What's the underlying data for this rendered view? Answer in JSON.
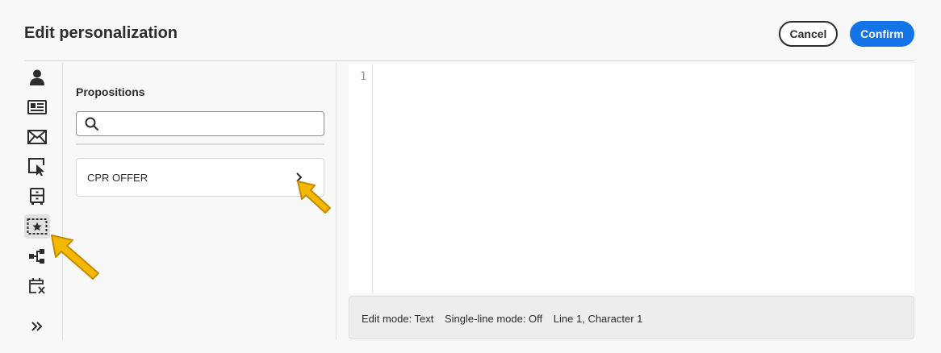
{
  "header": {
    "title": "Edit personalization",
    "cancel_label": "Cancel",
    "confirm_label": "Confirm"
  },
  "rail": {
    "items": [
      {
        "icon": "profile-icon"
      },
      {
        "icon": "audience-icon"
      },
      {
        "icon": "email-icon"
      },
      {
        "icon": "interaction-icon"
      },
      {
        "icon": "cabinet-icon"
      },
      {
        "icon": "offer-star-icon",
        "selected": true
      },
      {
        "icon": "flow-icon"
      },
      {
        "icon": "calendar-x-icon"
      },
      {
        "icon": "expand-chevron-double-icon"
      }
    ]
  },
  "panel": {
    "title": "Propositions",
    "search": {
      "value": "",
      "placeholder": ""
    },
    "items": [
      {
        "label": "CPR OFFER"
      }
    ]
  },
  "editor": {
    "line_numbers": [
      "1"
    ],
    "content": ""
  },
  "status": {
    "edit_mode": "Edit mode: Text",
    "single_line": "Single-line mode: Off",
    "position": "Line 1, Character 1"
  },
  "colors": {
    "accent": "#1473e6",
    "callout_arrow": "#f5b800"
  }
}
